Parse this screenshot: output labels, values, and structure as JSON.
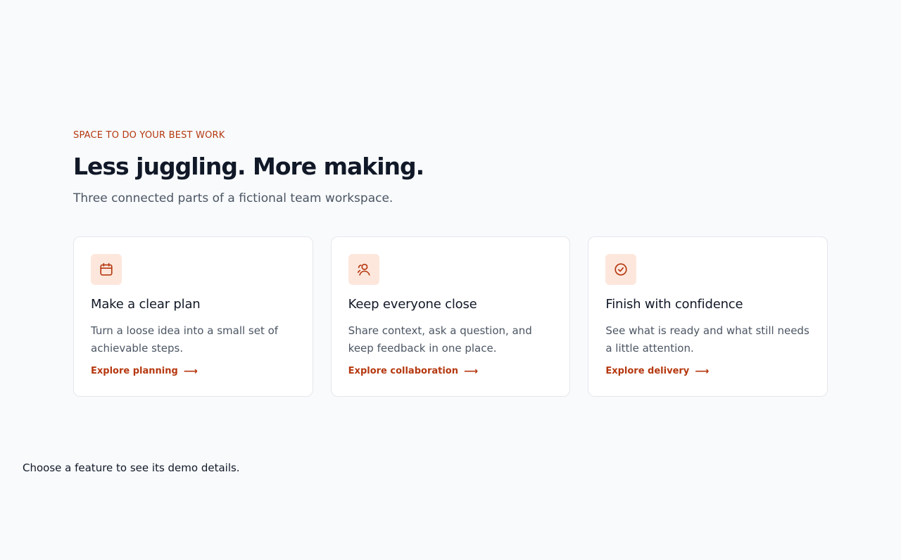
{
  "hero": {
    "eyebrow": "SPACE TO DO YOUR BEST WORK",
    "headline": "Less juggling. More making.",
    "subtitle": "Three connected parts of a fictional team workspace."
  },
  "cards": [
    {
      "icon": "calendar-icon",
      "title": "Make a clear plan",
      "description": "Turn a loose idea into a small set of achievable steps.",
      "link": "Explore planning"
    },
    {
      "icon": "people-icon",
      "title": "Keep everyone close",
      "description": "Share context, ask a question, and keep feedback in one place.",
      "link": "Explore collaboration"
    },
    {
      "icon": "check-circle-icon",
      "title": "Finish with confidence",
      "description": "See what is ready and what still needs a little attention.",
      "link": "Explore delivery"
    }
  ],
  "status": {
    "message": "Choose a feature to see its demo details."
  },
  "colors": {
    "accent": "#b5380f",
    "icon_tile": "#fde7dd",
    "background": "#f8fafc",
    "card": "#ffffff",
    "heading": "#111827",
    "muted": "#4b5563"
  }
}
